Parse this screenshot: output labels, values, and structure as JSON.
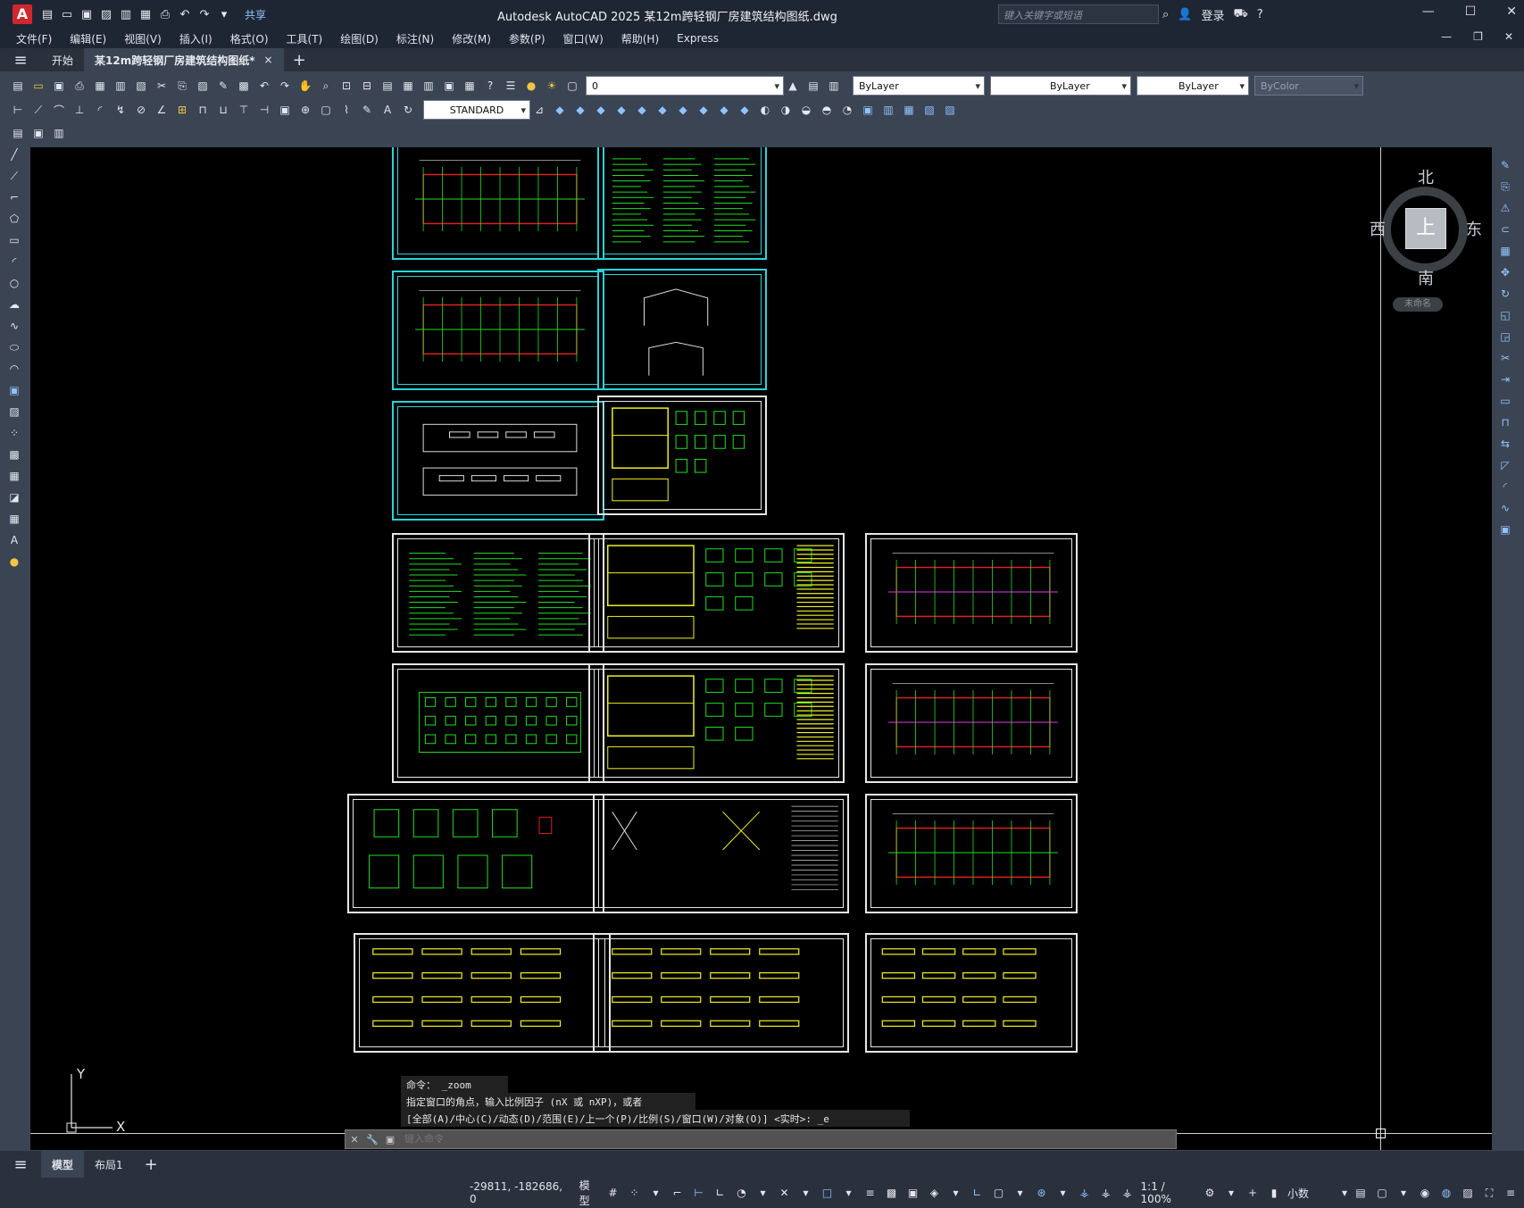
{
  "title_bar": {
    "logo": "A",
    "share_label": "共享",
    "app_title": "Autodesk AutoCAD 2025    某12m跨轻钢厂房建筑结构图纸.dwg",
    "search_placeholder": "键入关键字或短语",
    "login_label": "登录"
  },
  "menu": {
    "items": [
      "文件(F)",
      "编辑(E)",
      "视图(V)",
      "插入(I)",
      "格式(O)",
      "工具(T)",
      "绘图(D)",
      "标注(N)",
      "修改(M)",
      "参数(P)",
      "窗口(W)",
      "帮助(H)",
      "Express"
    ]
  },
  "tabs": {
    "start": "开始",
    "doc": "某12m跨轻钢厂房建筑结构图纸*",
    "close": "×",
    "add": "+"
  },
  "toolbar": {
    "layer_value": "0",
    "color": "ByLayer",
    "linetype": "ByLayer",
    "lineweight": "ByLayer",
    "plotstyle": "ByColor",
    "text_style": "STANDARD"
  },
  "viewcube": {
    "north": "北",
    "south": "南",
    "east": "东",
    "west": "西",
    "top_face": "上",
    "wcs": "未命名"
  },
  "ucs": {
    "x_label": "X",
    "y_label": "Y"
  },
  "command": {
    "history": [
      "命令：  _zoom",
      "指定窗口的角点，输入比例因子 (nX 或 nXP)，或者",
      "[全部(A)/中心(C)/动态(D)/范围(E)/上一个(P)/比例(S)/窗口(W)/对象(O)] <实时>:  _e"
    ],
    "placeholder": "键入命令"
  },
  "layout_tabs": {
    "model": "模型",
    "layout1": "布局1",
    "add": "+"
  },
  "status": {
    "coords": "-29811, -182686, 0",
    "model": "模型",
    "scale": "1:1 / 100%",
    "units": "小数"
  },
  "colors": {
    "canvas": "#000000",
    "cyan_frame": "#2bd3d8",
    "white_frame": "#e6e6e6",
    "green": "#22dd22",
    "red": "#e02020",
    "yellow": "#f0f020",
    "magenta": "#e040e0"
  }
}
